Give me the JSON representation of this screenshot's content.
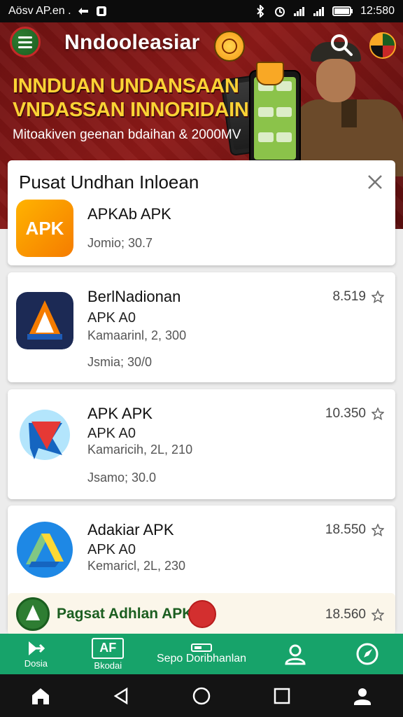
{
  "status_bar": {
    "carrier_text": "Aösv AP.en .",
    "time": "12:580"
  },
  "header": {
    "app_title": "Nndooleasiar",
    "hero_headline_line1": "INNDUAN UNDANSAAN",
    "hero_headline_line2": "VNDASSAN INNORIDAIN",
    "hero_subtitle": "Mitoakiven geenan bdaihan & 2000MV"
  },
  "panel": {
    "title": "Pusat Undhan Inloean",
    "first_app": {
      "icon_text": "APK",
      "name": "APKAb APK",
      "size": "Jomio; 30.7"
    }
  },
  "apps": [
    {
      "name": "BerlNadionan",
      "subtitle": "APK A0",
      "meta": "Kamaarinl, 2, 300",
      "size": "Jsmia; 30/0",
      "rating": "8.519",
      "icon": "triangle-shield-icon"
    },
    {
      "name": "APK APK",
      "subtitle": "APK A0",
      "meta": "Kamaricih, 2L, 210",
      "size": "Jsamo; 30.0",
      "rating": "10.350",
      "icon": "red-arrow-chat-icon"
    },
    {
      "name": "Adakiar APK",
      "subtitle": "APK A0",
      "meta": "Kemaricl, 2L, 230",
      "size": "",
      "rating": "18.550",
      "icon": "blue-triangle-icon"
    }
  ],
  "promo": {
    "label": "Pagsat Adhlan APK",
    "rating": "18.560"
  },
  "tabbar": {
    "tab1_label": "Dosia",
    "tab2_icon_text": "AF",
    "tab2_label": "Bkodai",
    "tab3_label": "Sepo Doribhanlan"
  },
  "colors": {
    "accent_green": "#17a36a",
    "hero_red": "#8c1a18",
    "headline_yellow": "#fbd335"
  }
}
